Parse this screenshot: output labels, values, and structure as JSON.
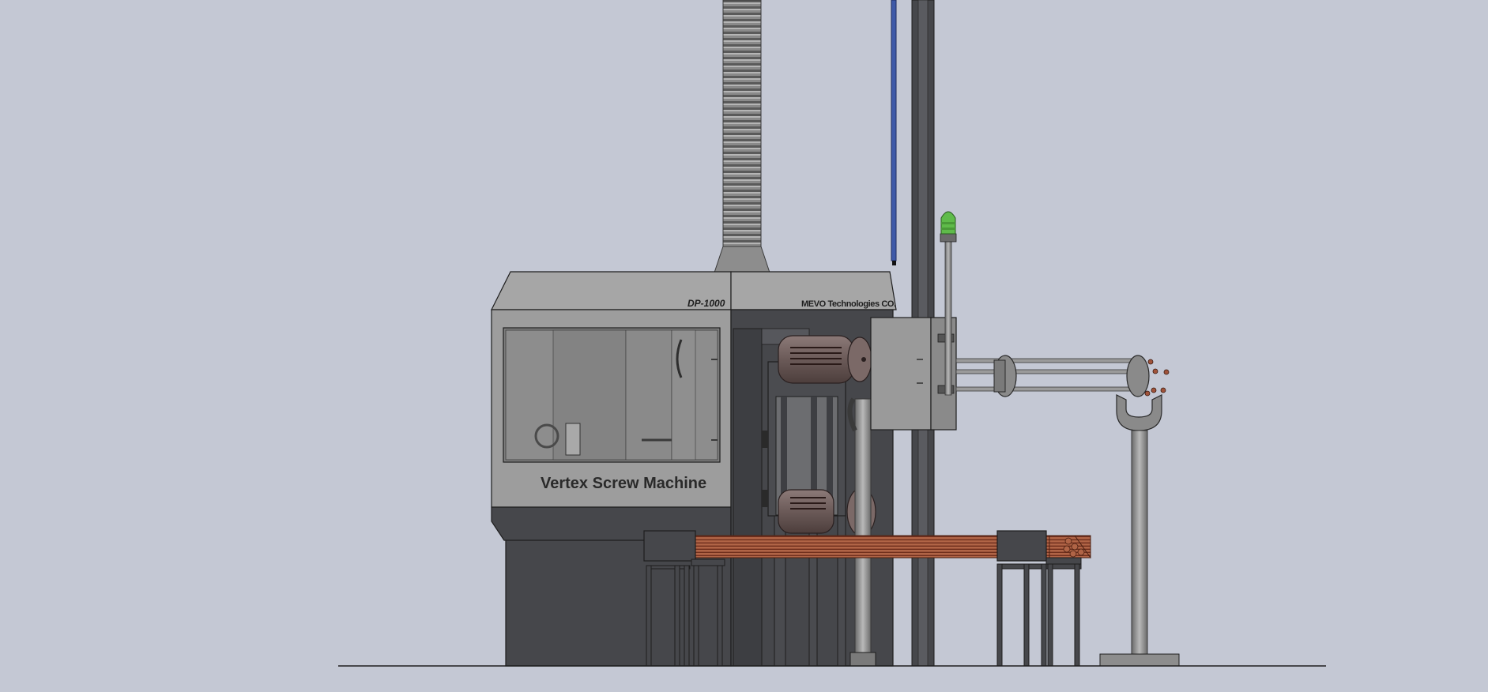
{
  "machine": {
    "model": "DP-1000",
    "maker": "MEVO Technologies CO.",
    "brand": "Vertex Screw Machine"
  },
  "colors": {
    "background": "#c4c8d4",
    "body_light": "#9d9d9d",
    "body_dark": "#46474b",
    "window_glass": "#8d8d8d",
    "copper_rods": "#a0533a",
    "beacon": "#5fbb4a",
    "cable": "#3f5aa8",
    "outline": "#1e1e1e"
  },
  "icons": [
    "exhaust-duct-icon",
    "signal-beacon-icon",
    "motor-icon",
    "bar-feeder-icon"
  ]
}
